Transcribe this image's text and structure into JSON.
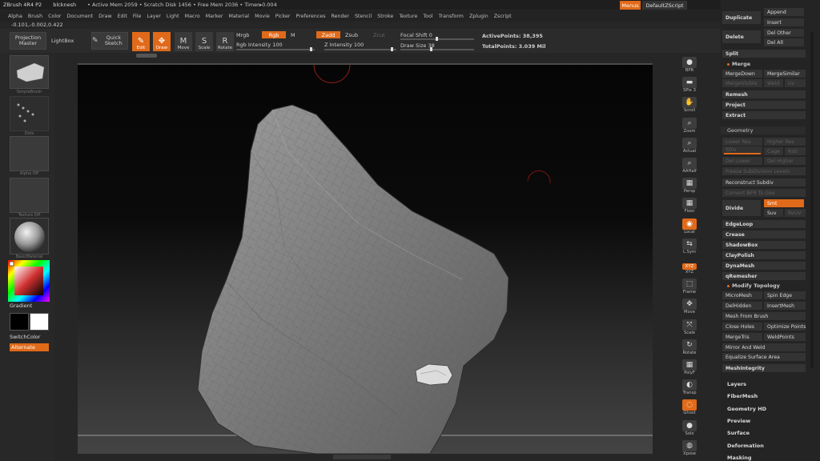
{
  "title": {
    "app": "ZBrush 4R4 P2",
    "doc": "blcknesh",
    "stats": "• Active Mem 2059 • Scratch Disk 1456 • Free Mem 2036 • Timer▸0.004",
    "menus": "Menus",
    "script": "DefaultZScript",
    "controls": [
      "◦",
      "–",
      "□",
      "✕"
    ]
  },
  "menubar": [
    "Alpha",
    "Brush",
    "Color",
    "Document",
    "Draw",
    "Edit",
    "File",
    "Layer",
    "Light",
    "Macro",
    "Marker",
    "Material",
    "Movie",
    "Picker",
    "Preferences",
    "Render",
    "Stencil",
    "Stroke",
    "Texture",
    "Tool",
    "Transform",
    "Zplugin",
    "Zscript"
  ],
  "coords": "-0.101,-0.002,0.422",
  "shelf": {
    "projection_master": "Projection Master",
    "lightbox": "LightBox",
    "quick_sketch": "Quick Sketch",
    "tools": [
      {
        "label": "Edit",
        "icon": "edit-icon",
        "glyph": "✎",
        "active": true
      },
      {
        "label": "Draw",
        "icon": "draw-icon",
        "glyph": "✥",
        "active": true
      },
      {
        "label": "Move",
        "icon": "move-icon",
        "glyph": "M",
        "active": false
      },
      {
        "label": "Scale",
        "icon": "scale-icon",
        "glyph": "S",
        "active": false
      },
      {
        "label": "Rotate",
        "icon": "rotate-icon",
        "glyph": "R",
        "active": false
      }
    ],
    "mrgb": "Mrgb",
    "rgb": "Rgb",
    "m": "M",
    "rgb_intensity": "Rgb Intensity 100",
    "zadd": "Zadd",
    "zsub": "Zsub",
    "zcut": "Zcut",
    "z_intensity": "Z Intensity 100",
    "focal_shift": "Focal Shift 0",
    "draw_size": "Draw Size 38",
    "active_points": "ActivePoints: 38,395",
    "total_points": "TotalPoints: 3.039 Mil"
  },
  "left_tray": {
    "thumbs": [
      "SimpleBrush",
      "Dots",
      "Alpha Off",
      "Texture Off",
      "BasicMaterial"
    ],
    "gradient": "Gradient",
    "switch_color": "SwitchColor",
    "alternate": "Alternate"
  },
  "right_bar": [
    {
      "label": "BPR",
      "icon": "bpr-icon",
      "glyph": "●"
    },
    {
      "label": "SPix 3",
      "icon": "spix-icon",
      "glyph": "▬"
    },
    {
      "label": "Scroll",
      "icon": "scroll-hand-icon",
      "glyph": "✋"
    },
    {
      "label": "Zoom",
      "icon": "zoom-icon",
      "glyph": "⌕"
    },
    {
      "label": "Actual",
      "icon": "actual-icon",
      "glyph": "⌕"
    },
    {
      "label": "AAHalf",
      "icon": "aahalf-icon",
      "glyph": "⌕"
    },
    {
      "label": "Persp",
      "icon": "persp-icon",
      "glyph": "▦"
    },
    {
      "label": "Floor",
      "icon": "floor-icon",
      "glyph": "▦"
    },
    {
      "label": "Local",
      "icon": "local-icon",
      "glyph": "◉",
      "active": true
    },
    {
      "label": "L.Sym",
      "icon": "lsym-icon",
      "glyph": "⇆"
    },
    {
      "label": "XYZ",
      "icon": "xyz-icon",
      "glyph": "XYZ",
      "active": true
    },
    {
      "label": "Frame",
      "icon": "frame-icon",
      "glyph": "⬚"
    },
    {
      "label": "Move",
      "icon": "move-view-icon",
      "glyph": "✥"
    },
    {
      "label": "Scale",
      "icon": "scale-view-icon",
      "glyph": "⤧"
    },
    {
      "label": "Rotate",
      "icon": "rotate-view-icon",
      "glyph": "↻"
    },
    {
      "label": "PolyF",
      "icon": "polyf-icon",
      "glyph": "▦"
    },
    {
      "label": "Transp",
      "icon": "transp-icon",
      "glyph": "◐"
    },
    {
      "label": "Ghost",
      "icon": "ghost-icon",
      "glyph": "◌",
      "active": true
    },
    {
      "label": "Solo",
      "icon": "solo-icon",
      "glyph": "●"
    },
    {
      "label": "Xpose",
      "icon": "xpose-icon",
      "glyph": "◍"
    }
  ],
  "palette": {
    "subtool": {
      "duplicate": "Duplicate",
      "append": "Append",
      "insert": "Insert",
      "delete": "Delete",
      "del_other": "Del Other",
      "del_all": "Del All",
      "split": "Split",
      "merge": "Merge",
      "merge_down": "MergeDown",
      "merge_similar": "MergeSimilar",
      "merge_visible": "MergeVisible",
      "weld": "Weld",
      "uv": "Uv",
      "remesh": "Remesh",
      "project": "Project",
      "extract": "Extract"
    },
    "geometry": {
      "header": "Geometry",
      "lower_res": "Lower Res",
      "higher_res": "Higher Res",
      "sdiv": "SDiv",
      "cage": "Cage",
      "rstr": "Rstr",
      "del_lower": "Del Lower",
      "del_higher": "Del Higher",
      "freeze": "Freeze SubDivision Levels",
      "reconstruct": "Reconstruct Subdiv",
      "convert_bpr": "Convert BPR To Geo",
      "divide": "Divide",
      "smt": "Smt",
      "suv": "Suv",
      "reuv": "ReUV",
      "edgeloop": "EdgeLoop",
      "crease": "Crease",
      "shadowbox": "ShadowBox",
      "claypolish": "ClayPolish",
      "dynamesh": "DynaMesh",
      "qremesher": "qRemesher",
      "modify_topology": "Modify Topology",
      "micromesh": "MicroMesh",
      "spin_edge": "Spin Edge",
      "delhidden": "DelHidden",
      "insertmesh": "InsertMesh",
      "mesh_from_brush": "Mesh From Brush",
      "close_holes": "Close Holes",
      "optimize_points": "Optimize Points",
      "mergetris": "MergeTris",
      "weldpoints": "WeldPoints",
      "mirror_weld": "Mirror And Weld",
      "equalize": "Equalize Surface Area",
      "meshintegrity": "MeshIntegrity"
    },
    "links": [
      "Layers",
      "FiberMesh",
      "Geometry HD",
      "Preview",
      "Surface",
      "Deformation",
      "Masking"
    ]
  }
}
